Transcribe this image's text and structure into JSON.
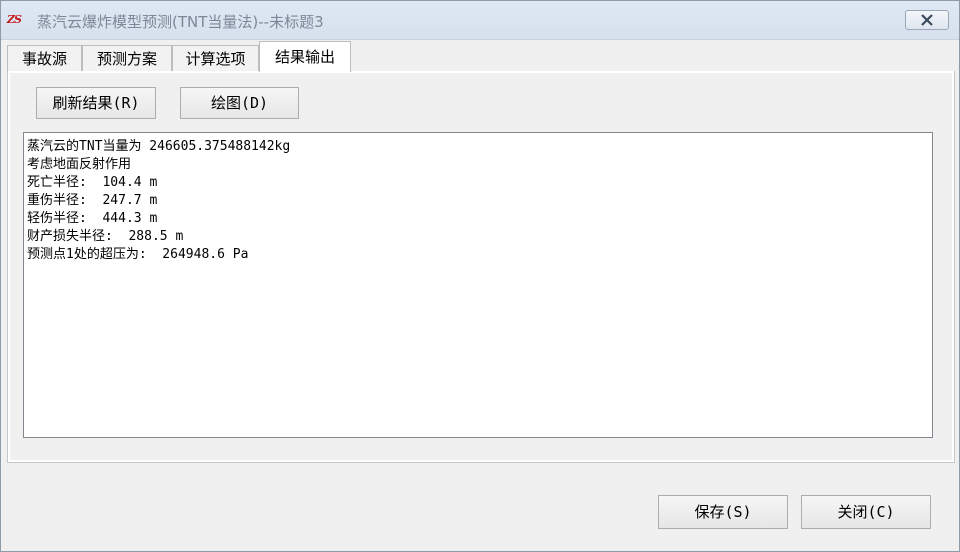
{
  "window": {
    "icon_text": "ZS",
    "title": "蒸汽云爆炸模型预测(TNT当量法)--未标题3"
  },
  "tabs": [
    {
      "label": "事故源",
      "active": false
    },
    {
      "label": "预测方案",
      "active": false
    },
    {
      "label": "计算选项",
      "active": false
    },
    {
      "label": "结果输出",
      "active": true
    }
  ],
  "toolbar": {
    "refresh_label": "刷新结果(R)",
    "plot_label": "绘图(D)"
  },
  "results": [
    "蒸汽云的TNT当量为 246605.375488142kg",
    "考虑地面反射作用",
    "死亡半径:  104.4 m",
    "重伤半径:  247.7 m",
    "轻伤半径:  444.3 m",
    "财产损失半径:  288.5 m",
    "预测点1处的超压为:  264948.6 Pa"
  ],
  "footer": {
    "save_label": "保存(S)",
    "close_label": "关闭(C)"
  },
  "icons": {
    "close": "close-icon"
  }
}
